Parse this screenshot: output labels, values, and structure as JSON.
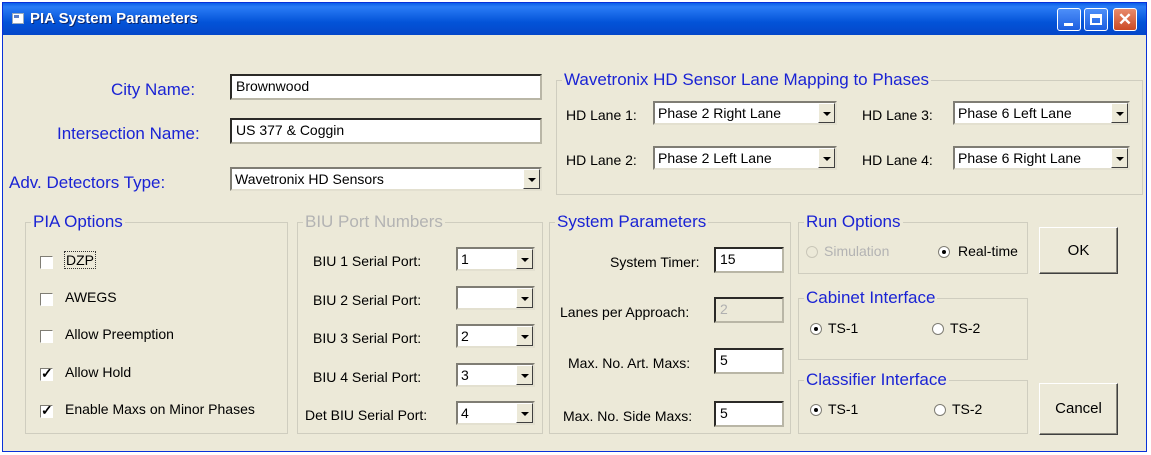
{
  "window": {
    "title": "PIA System Parameters"
  },
  "general": {
    "city_label": "City Name:",
    "city_value": "Brownwood",
    "intersection_label": "Intersection Name:",
    "intersection_value": "US 377 & Coggin",
    "adv_label": "Adv. Detectors Type:",
    "adv_value": "Wavetronix HD Sensors"
  },
  "lane_mapping": {
    "title": "Wavetronix HD Sensor Lane Mapping to Phases",
    "lanes": [
      {
        "label": "HD Lane 1:",
        "value": "Phase 2 Right Lane"
      },
      {
        "label": "HD Lane 2:",
        "value": "Phase 2 Left Lane"
      },
      {
        "label": "HD Lane 3:",
        "value": "Phase 6 Left Lane"
      },
      {
        "label": "HD Lane 4:",
        "value": "Phase 6 Right Lane"
      }
    ]
  },
  "pia_options": {
    "title": "PIA Options",
    "items": [
      {
        "label": "DZP",
        "checked": false
      },
      {
        "label": "AWEGS",
        "checked": false
      },
      {
        "label": "Allow Preemption",
        "checked": false
      },
      {
        "label": "Allow Hold",
        "checked": true
      },
      {
        "label": "Enable Maxs on Minor Phases",
        "checked": true
      }
    ]
  },
  "biu_ports": {
    "title": "BIU Port Numbers",
    "ports": [
      {
        "label": "BIU 1 Serial Port:",
        "value": "1"
      },
      {
        "label": "BIU 2 Serial Port:",
        "value": ""
      },
      {
        "label": "BIU 3 Serial Port:",
        "value": "2"
      },
      {
        "label": "BIU 4 Serial Port:",
        "value": "3"
      },
      {
        "label": "Det BIU Serial Port:",
        "value": "4"
      }
    ]
  },
  "system_params": {
    "title": "System Parameters",
    "timer_label": "System Timer:",
    "timer_value": "15",
    "lanes_label": "Lanes per Approach:",
    "lanes_value": "2",
    "art_label": "Max. No. Art. Maxs:",
    "art_value": "5",
    "side_label": "Max. No. Side Maxs:",
    "side_value": "5"
  },
  "run_options": {
    "title": "Run Options",
    "simulation": "Simulation",
    "realtime": "Real-time",
    "selected": "Real-time"
  },
  "cabinet_interface": {
    "title": "Cabinet Interface",
    "opt1": "TS-1",
    "opt2": "TS-2",
    "selected": "TS-1"
  },
  "classifier_interface": {
    "title": "Classifier Interface",
    "opt1": "TS-1",
    "opt2": "TS-2",
    "selected": "TS-1"
  },
  "buttons": {
    "ok": "OK",
    "cancel": "Cancel"
  },
  "colors": {
    "label_blue": "#1a23d4",
    "titlebar": "#0353d8",
    "face": "#ece9d8"
  }
}
